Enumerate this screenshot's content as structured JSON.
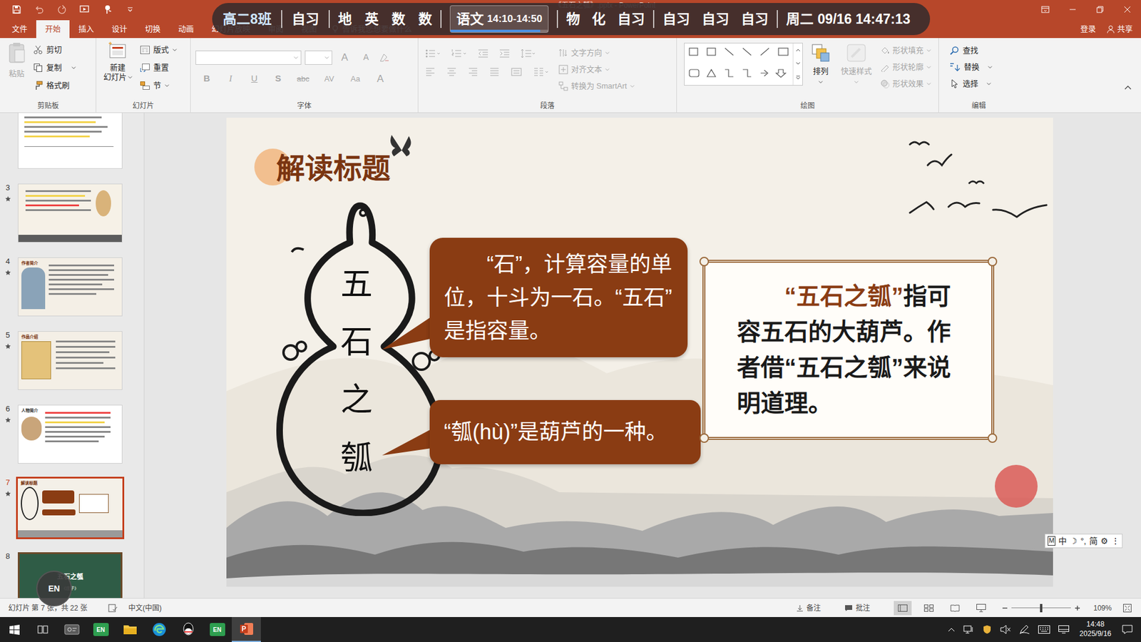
{
  "window": {
    "title": "《五石之瓠》.pptx - PowerPoint"
  },
  "schedule": {
    "class_name": "高二8班",
    "groups": [
      [
        {
          "label": "自习",
          "current": false
        }
      ],
      [
        {
          "label": "地",
          "current": false
        },
        {
          "label": "英",
          "current": false
        },
        {
          "label": "数",
          "current": false
        },
        {
          "label": "数",
          "current": false
        }
      ],
      [
        {
          "label": "语文",
          "time": "14:10-14:50",
          "current": true,
          "level": 0.92
        }
      ],
      [
        {
          "label": "物",
          "current": false
        },
        {
          "label": "化",
          "current": false
        },
        {
          "label": "自习",
          "current": false
        }
      ],
      [
        {
          "label": "自习",
          "current": false
        },
        {
          "label": "自习",
          "current": false
        },
        {
          "label": "自习",
          "current": false
        }
      ]
    ],
    "clock": "周二 09/16 14:47:13"
  },
  "menu_tabs": [
    {
      "label": "文件",
      "selected": false
    },
    {
      "label": "开始",
      "selected": true
    },
    {
      "label": "插入",
      "selected": false
    },
    {
      "label": "设计",
      "selected": false
    },
    {
      "label": "切换",
      "selected": false
    },
    {
      "label": "动画",
      "selected": false
    },
    {
      "label": "幻灯片放映",
      "selected": false
    },
    {
      "label": "审阅",
      "selected": false
    },
    {
      "label": "视图",
      "selected": false
    }
  ],
  "tell_me": "告诉我您想要做什么",
  "account": {
    "sign_in": "登录",
    "share": "共享"
  },
  "ribbon": {
    "clipboard": {
      "label": "剪贴板",
      "paste": {
        "label": "粘贴",
        "disabled": true
      },
      "cut": {
        "label": "剪切",
        "disabled": false
      },
      "copy": {
        "label": "复制",
        "disabled": false
      },
      "format_painter": {
        "label": "格式刷",
        "disabled": false
      }
    },
    "slides": {
      "label": "幻灯片",
      "new_slide": {
        "label": "新建",
        "label2": "幻灯片",
        "disabled": false
      },
      "layout": {
        "label": "版式",
        "disabled": false
      },
      "reset": {
        "label": "重置",
        "disabled": false
      },
      "section": {
        "label": "节",
        "disabled": false
      }
    },
    "font": {
      "label": "字体",
      "top": [
        {
          "label": "A",
          "disabled": true
        },
        {
          "label": "A",
          "disabled": true
        }
      ],
      "buttons": [
        {
          "label": "B",
          "disabled": true
        },
        {
          "label": "I",
          "disabled": true
        },
        {
          "label": "U",
          "disabled": true
        },
        {
          "label": "S",
          "disabled": true
        },
        {
          "label": "abc",
          "disabled": true
        },
        {
          "label": "AV",
          "disabled": true
        },
        {
          "label": "Aa",
          "disabled": true
        },
        {
          "label": "A",
          "disabled": true
        }
      ]
    },
    "paragraph": {
      "label": "段落",
      "direction": {
        "label": "文字方向",
        "disabled": true
      },
      "align_text": {
        "label": "对齐文本",
        "disabled": true
      },
      "smartart": {
        "label": "转换为 SmartArt",
        "disabled": true
      }
    },
    "drawing": {
      "label": "绘图",
      "arrange": {
        "label": "排列",
        "disabled": false
      },
      "quick_styles": {
        "label": "快速样式",
        "disabled": true
      },
      "fill": {
        "label": "形状填充",
        "disabled": true
      },
      "outline": {
        "label": "形状轮廓",
        "disabled": true
      },
      "effects": {
        "label": "形状效果",
        "disabled": true
      }
    },
    "editing": {
      "label": "编辑",
      "find": {
        "label": "查找",
        "disabled": false
      },
      "replace": {
        "label": "替换",
        "disabled": false
      },
      "select": {
        "label": "选择",
        "disabled": false
      }
    }
  },
  "thumbnails": [
    {
      "animated": false,
      "selected": false
    },
    {
      "number": "3",
      "animated": true,
      "selected": false
    },
    {
      "number": "4",
      "animated": true,
      "selected": false,
      "title": "作者简介"
    },
    {
      "number": "5",
      "animated": true,
      "selected": false,
      "title": "作品介绍"
    },
    {
      "number": "6",
      "animated": true,
      "selected": false,
      "title": "人物简介"
    },
    {
      "number": "7",
      "animated": true,
      "selected": true,
      "title": "解读标题"
    },
    {
      "number": "8",
      "animated": false,
      "selected": false,
      "title": "五石之瓠",
      "subtitle": "《庄子》"
    }
  ],
  "slide": {
    "title": "解读标题",
    "gourd_text": "五石之瓠",
    "bubbles": [
      "“石”，计算容量的单位，十斗为一石。“五石”是指容量。",
      "“瓠(hù)”是葫芦的一种。"
    ],
    "box": {
      "highlight": "“五石之瓠”",
      "text": "指可容五石的大葫芦。作者借“五石之瓠”来说明道理。"
    }
  },
  "ime": [
    "M",
    "中",
    "☽",
    "°,",
    "简",
    "⚙",
    "⋮"
  ],
  "floating_badge": "EN",
  "status_bar": {
    "slide_info": "幻灯片 第 7 张，共 22 张",
    "language": "中文(中国)",
    "notes": "备注",
    "comments": "批注",
    "views": [
      {
        "selected": true
      },
      {
        "selected": false
      },
      {
        "selected": false
      },
      {
        "selected": false
      }
    ],
    "zoom_level": 0.5,
    "zoom": "109%"
  },
  "taskbar": {
    "apps": [
      {
        "active": false
      },
      {
        "label": "EN",
        "active": false
      },
      {
        "active": false
      },
      {
        "active": false
      },
      {
        "active": false
      },
      {
        "label": "EN",
        "active": false
      },
      {
        "active": true
      }
    ],
    "time": "14:48",
    "date": "2025/9/16"
  }
}
